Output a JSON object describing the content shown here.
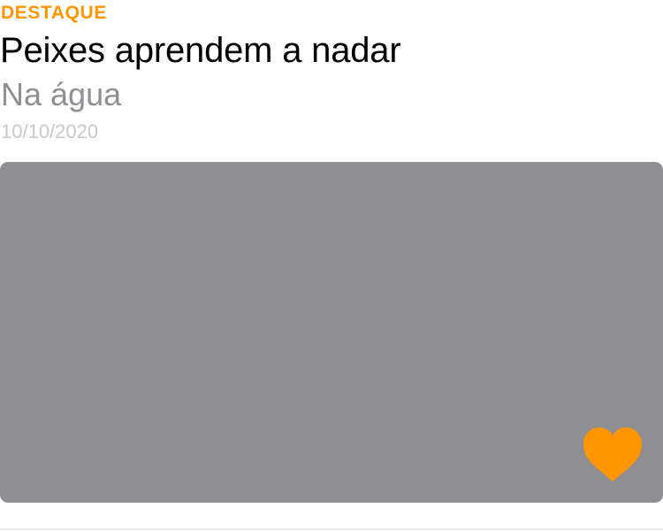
{
  "article": {
    "kicker": "DESTAQUE",
    "title": "Peixes aprendem a nadar",
    "subtitle": "Na água",
    "date": "10/10/2020"
  },
  "favorite": {
    "icon": "heart-icon",
    "state": "filled"
  },
  "colors": {
    "accent": "#FF9500",
    "title": "#000000",
    "subtitle": "#8E8E93",
    "date": "#C7C7CC",
    "image_placeholder": "#8E8E93",
    "separator": "#E5E5EA",
    "background": "#FFFFFF"
  }
}
